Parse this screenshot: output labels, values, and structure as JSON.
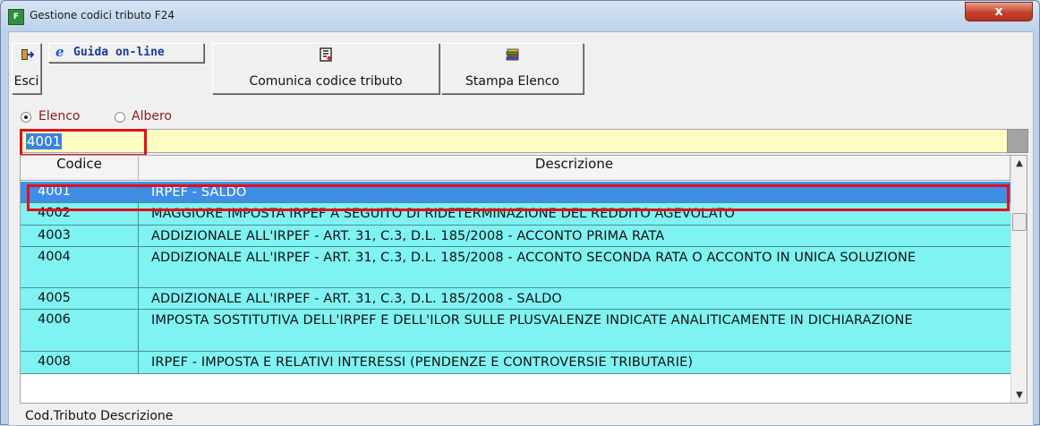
{
  "window": {
    "title": "Gestione codici tributo F24",
    "app_icon": "F24-app-icon",
    "close_label": "x"
  },
  "toolbar": {
    "exit_label": "Esci",
    "guide_label": "Guida on-line",
    "communicate_label": "Comunica codice tributo",
    "print_label": "Stampa Elenco"
  },
  "view_mode": {
    "options": [
      "Elenco",
      "Albero"
    ],
    "selected": "Elenco"
  },
  "search": {
    "value": "4001"
  },
  "table": {
    "columns": [
      "Codice",
      "Descrizione"
    ],
    "rows": [
      {
        "code": "4001",
        "desc": "IRPEF - SALDO",
        "selected": true
      },
      {
        "code": "4002",
        "desc": "MAGGIORE IMPOSTA IRPEF A SEGUITO DI RIDETERMINAZIONE DEL REDDITO AGEVOLATO",
        "selected": false
      },
      {
        "code": "4003",
        "desc": "ADDIZIONALE ALL'IRPEF - ART. 31, C.3, D.L. 185/2008 - ACCONTO PRIMA RATA",
        "selected": false
      },
      {
        "code": "4004",
        "desc": "ADDIZIONALE ALL'IRPEF - ART. 31, C.3, D.L. 185/2008 - ACCONTO SECONDA RATA O ACCONTO IN UNICA SOLUZIONE",
        "selected": false
      },
      {
        "code": "4005",
        "desc": "ADDIZIONALE ALL'IRPEF - ART. 31, C.3, D.L. 185/2008 - SALDO",
        "selected": false
      },
      {
        "code": "4006",
        "desc": "IMPOSTA SOSTITUTIVA DELL'IRPEF E DELL'ILOR SULLE PLUSVALENZE INDICATE ANALITICAMENTE IN DICHIARAZIONE",
        "selected": false
      },
      {
        "code": "4008",
        "desc": "IRPEF - IMPOSTA E RELATIVI INTERESSI (PENDENZE E CONTROVERSIE TRIBUTARIE)",
        "selected": false
      }
    ]
  },
  "footer": {
    "label": "Cod.Tributo  Descrizione"
  },
  "colors": {
    "row_bg": "#7ff2f2",
    "selected_row_bg": "#3e8ee6",
    "highlight_border": "#e0101a",
    "search_bg": "#fcfcc4"
  }
}
